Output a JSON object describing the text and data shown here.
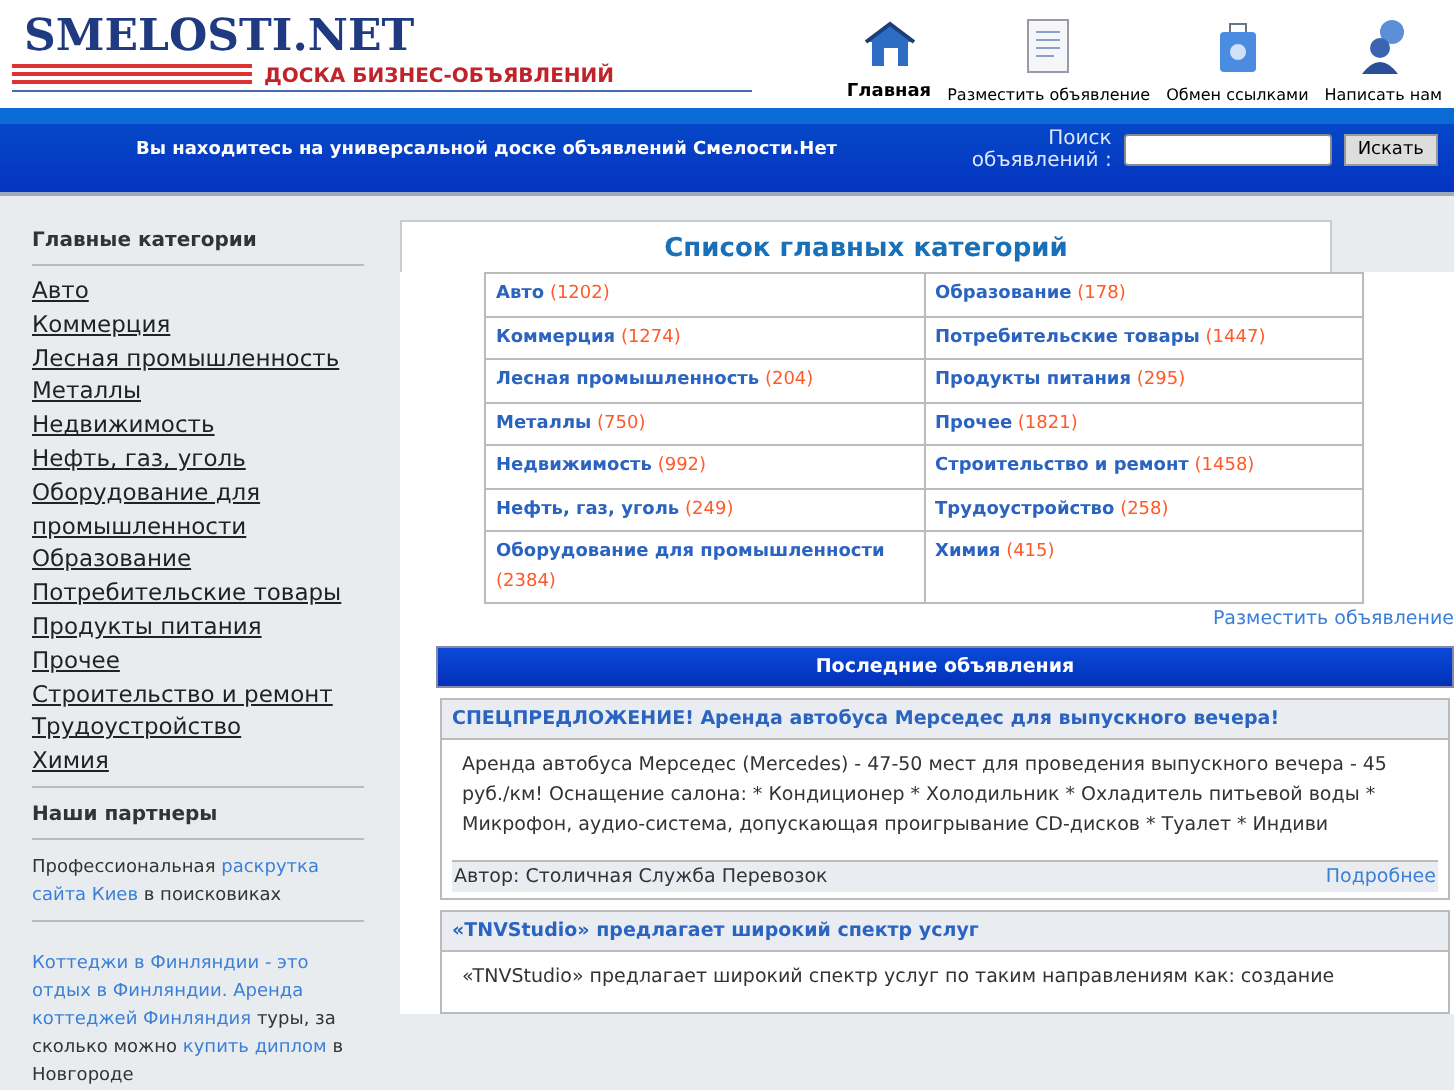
{
  "logo": {
    "title": "SMELOSTI.NET",
    "subtitle": "ДОСКА БИЗНЕС-ОБЪЯВЛЕНИЙ"
  },
  "nav": [
    {
      "label": "Главная",
      "selected": true
    },
    {
      "label": "Разместить объявление",
      "selected": false
    },
    {
      "label": "Обмен ссылками",
      "selected": false
    },
    {
      "label": "Написать нам",
      "selected": false
    }
  ],
  "banner": {
    "text": "Вы находитесь на универсальной доске объявлений Смелости.Нет",
    "search_label": "Поиск объявлений :",
    "search_button": "Искать"
  },
  "sidebar": {
    "categories_title": "Главные категории",
    "categories": [
      "Авто",
      "Коммерция",
      "Лесная промышленность",
      "Металлы",
      "Недвижимость",
      "Нефть, газ, уголь",
      "Оборудование для промышленности",
      "Образование",
      "Потребительские товары",
      "Продукты питания",
      "Прочее",
      "Строительство и ремонт",
      "Трудоустройство",
      "Химия"
    ],
    "partners_title": "Наши партнеры",
    "partner_blocks": [
      [
        {
          "text": "Профессиональная",
          "kind": "text"
        },
        {
          "text": "раскрутка",
          "kind": "link"
        },
        {
          "text": "сайта Киев",
          "kind": "link"
        },
        {
          "text": "в поисковиках",
          "kind": "text"
        }
      ],
      [
        {
          "text": "Коттеджи в Финляндии - это",
          "kind": "link"
        },
        {
          "text": "отдых в Финляндии. Аренда",
          "kind": "link"
        },
        {
          "text": "коттеджей Финляндия",
          "kind": "link"
        },
        {
          "text": "туры, за сколько можно",
          "kind": "text"
        },
        {
          "text": "купить диплом",
          "kind": "link"
        },
        {
          "text": "в Новгороде",
          "kind": "text"
        }
      ]
    ]
  },
  "main": {
    "title": "Список главных категорий",
    "categories": [
      {
        "name": "Авто",
        "count": "(1202)"
      },
      {
        "name": "Коммерция",
        "count": "(1274)"
      },
      {
        "name": "Лесная промышленность",
        "count": "(204)"
      },
      {
        "name": "Металлы",
        "count": "(750)"
      },
      {
        "name": "Недвижимость",
        "count": "(992)"
      },
      {
        "name": "Нефть, газ, уголь",
        "count": "(249)"
      },
      {
        "name": "Оборудование для промышленности",
        "count": "(2384)"
      },
      {
        "name": "Образование",
        "count": "(178)"
      },
      {
        "name": "Потребительские товары",
        "count": "(1447)"
      },
      {
        "name": "Продукты питания",
        "count": "(295)"
      },
      {
        "name": "Прочее",
        "count": "(1821)"
      },
      {
        "name": "Строительство и ремонт",
        "count": "(1458)"
      },
      {
        "name": "Трудоустройство",
        "count": "(258)"
      },
      {
        "name": "Химия",
        "count": "(415)"
      }
    ],
    "post_link": "Разместить объявление",
    "latest_title": "Последние объявления",
    "ads": [
      {
        "title": "СПЕЦПРЕДЛОЖЕНИЕ! Аренда автобуса Мерседес для выпускного вечера!",
        "body": "Аренда автобуса Мерседес (Mercedes) - 47-50 мест для проведения выпускного вечера - 45 руб./км! Оснащение салона: * Кондиционер * Холодильник * Охладитель питьевой воды * Микрофон, аудио-система, допускающая проигрывание CD-дисков * Туалет * Индиви",
        "author": "Автор: Столичная Служба Перевозок",
        "more": "Подробнее"
      },
      {
        "title": "«TNVStudio» предлагает широкий спектр услуг",
        "body": "«TNVStudio» предлагает широкий спектр услуг по таким направлениям как: создание"
      }
    ]
  }
}
